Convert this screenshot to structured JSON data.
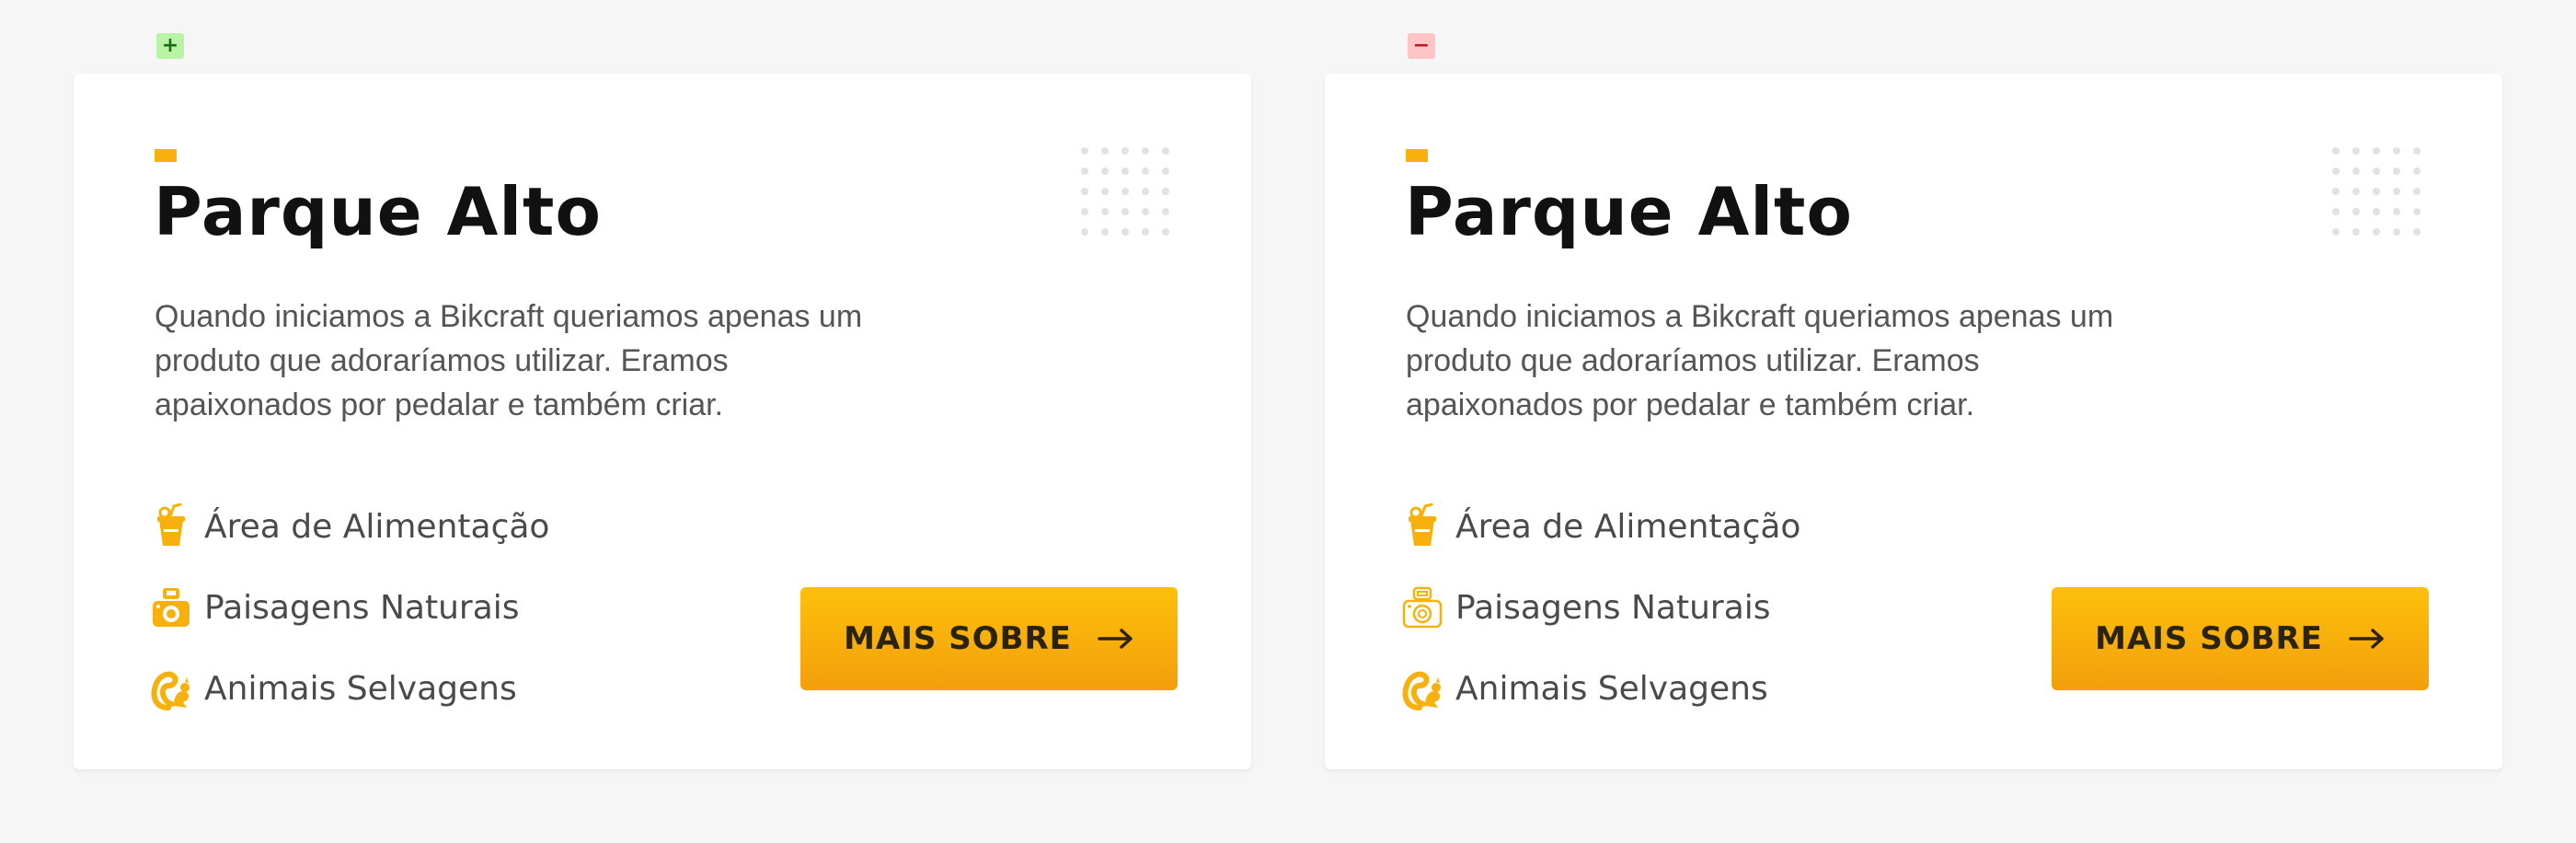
{
  "diff": {
    "added_symbol": "+",
    "removed_symbol": "−"
  },
  "colors": {
    "accent": "#f8b10c",
    "button_top": "#fdc00a",
    "button_bottom": "#f39f0c",
    "background": "#f6f6f6"
  },
  "cards": [
    {
      "version": "added",
      "title": "Parque Alto",
      "description": "Quando iniciamos a Bikcraft queriamos apenas um produto que adoraríamos utilizar. Eramos apaixonados por pedalar e também criar.",
      "features": [
        {
          "icon": "drink-icon",
          "label": "Área de Alimentação"
        },
        {
          "icon": "camera-icon",
          "label": "Paisagens Naturais"
        },
        {
          "icon": "squirrel-icon",
          "label": "Animais Selvagens"
        }
      ],
      "button_label": "MAIS SOBRE",
      "button_icon": "arrow-right-icon"
    },
    {
      "version": "removed",
      "title": "Parque Alto",
      "description": "Quando iniciamos a Bikcraft queriamos apenas um produto que adoraríamos utilizar. Eramos apaixonados por pedalar e também criar.",
      "features": [
        {
          "icon": "drink-icon",
          "label": "Área de Alimentação"
        },
        {
          "icon": "camera-outline-icon",
          "label": "Paisagens Naturais"
        },
        {
          "icon": "squirrel-icon",
          "label": "Animais Selvagens"
        }
      ],
      "button_label": "MAIS SOBRE",
      "button_icon": "arrow-right-icon"
    }
  ]
}
